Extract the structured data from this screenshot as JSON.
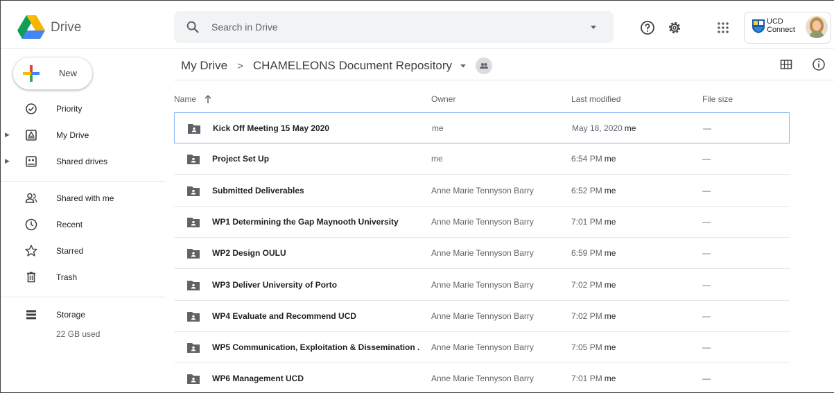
{
  "app": {
    "brand": "Drive"
  },
  "search": {
    "placeholder": "Search in Drive",
    "value": ""
  },
  "account": {
    "org_line1": "UCD",
    "org_line2": "Connect"
  },
  "sidebar": {
    "new_label": "New",
    "items": [
      {
        "label": "Priority",
        "icon": "priority-check-icon",
        "expandable": false
      },
      {
        "label": "My Drive",
        "icon": "my-drive-icon",
        "expandable": true
      },
      {
        "label": "Shared drives",
        "icon": "shared-drives-icon",
        "expandable": true
      },
      {
        "label": "Shared with me",
        "icon": "people-icon",
        "expandable": false
      },
      {
        "label": "Recent",
        "icon": "clock-icon",
        "expandable": false
      },
      {
        "label": "Starred",
        "icon": "star-icon",
        "expandable": false
      },
      {
        "label": "Trash",
        "icon": "trash-icon",
        "expandable": false
      }
    ],
    "storage": {
      "label": "Storage",
      "used": "22 GB used"
    }
  },
  "breadcrumb": {
    "root": "My Drive",
    "separator": ">",
    "current": "CHAMELEONS Document Repository"
  },
  "table": {
    "columns": {
      "name": "Name",
      "owner": "Owner",
      "last_modified": "Last modified",
      "file_size": "File size"
    },
    "rows": [
      {
        "name": "Kick Off Meeting 15 May 2020",
        "owner": "me",
        "modified": "May 18, 2020",
        "modified_by": "me",
        "size": "—",
        "selected": true
      },
      {
        "name": "Project Set Up",
        "owner": "me",
        "modified": "6:54 PM",
        "modified_by": "me",
        "size": "—",
        "selected": false
      },
      {
        "name": "Submitted Deliverables",
        "owner": "Anne Marie Tennyson Barry",
        "modified": "6:52 PM",
        "modified_by": "me",
        "size": "—",
        "selected": false
      },
      {
        "name": "WP1 Determining the Gap Maynooth University",
        "owner": "Anne Marie Tennyson Barry",
        "modified": "7:01 PM",
        "modified_by": "me",
        "size": "—",
        "selected": false
      },
      {
        "name": "WP2 Design OULU",
        "owner": "Anne Marie Tennyson Barry",
        "modified": "6:59 PM",
        "modified_by": "me",
        "size": "—",
        "selected": false
      },
      {
        "name": "WP3 Deliver University of Porto",
        "owner": "Anne Marie Tennyson Barry",
        "modified": "7:02 PM",
        "modified_by": "me",
        "size": "—",
        "selected": false
      },
      {
        "name": "WP4 Evaluate and Recommend UCD",
        "owner": "Anne Marie Tennyson Barry",
        "modified": "7:02 PM",
        "modified_by": "me",
        "size": "—",
        "selected": false
      },
      {
        "name": "WP5 Communication, Exploitation & Dissemination ...",
        "owner": "Anne Marie Tennyson Barry",
        "modified": "7:05 PM",
        "modified_by": "me",
        "size": "—",
        "selected": false
      },
      {
        "name": "WP6 Management UCD",
        "owner": "Anne Marie Tennyson Barry",
        "modified": "7:01 PM",
        "modified_by": "me",
        "size": "—",
        "selected": false
      }
    ]
  },
  "colors": {
    "selection_border": "#8ab4f8",
    "folder_icon": "#5f6368",
    "logo_green": "#0f9d58",
    "logo_yellow": "#f4b400",
    "logo_blue": "#4285f4"
  }
}
